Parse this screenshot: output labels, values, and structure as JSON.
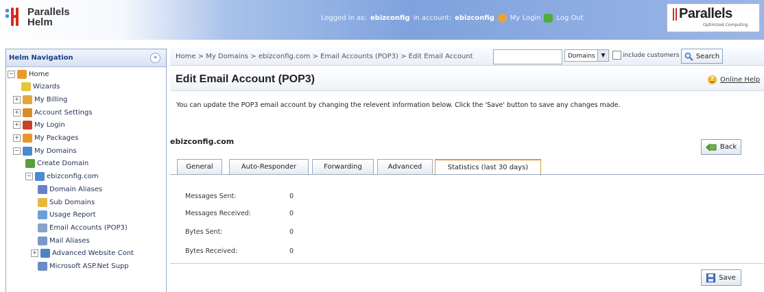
{
  "header": {
    "app_name_1": "Parallels",
    "app_name_2": "Helm",
    "logged_in_prefix": "Logged in as:",
    "logged_in_user": "ebizconfig",
    "account_prefix": "in account:",
    "account_name": "ebizconfig",
    "my_login": "My Login",
    "log_out": "Log Out",
    "brand_name": "Parallels",
    "brand_tagline": "Optimized Computing"
  },
  "sidebar": {
    "title": "Helm Navigation",
    "collapse_glyph": "«",
    "items": [
      {
        "label": "Home",
        "expander": "−",
        "icon": "home-icon",
        "color": "#e59b2a"
      },
      {
        "label": "Wizards",
        "expander": "",
        "icon": "wizard-icon",
        "color": "#e7c53a"
      },
      {
        "label": "My Billing",
        "expander": "+",
        "icon": "billing-icon",
        "color": "#e2a63b"
      },
      {
        "label": "Account Settings",
        "expander": "+",
        "icon": "account-settings-icon",
        "color": "#d98d2a"
      },
      {
        "label": "My Login",
        "expander": "+",
        "icon": "login-icon",
        "color": "#c8412a"
      },
      {
        "label": "My Packages",
        "expander": "+",
        "icon": "packages-icon",
        "color": "#e8962a"
      },
      {
        "label": "My Domains",
        "expander": "−",
        "icon": "domains-icon",
        "color": "#4c8ad0"
      },
      {
        "label": "Create Domain",
        "expander": "",
        "icon": "create-domain-icon",
        "color": "#5a9d3a"
      },
      {
        "label": "ebizconfig.com",
        "expander": "−",
        "icon": "domain-icon",
        "color": "#4c8ad0"
      },
      {
        "label": "Domain Aliases",
        "expander": "",
        "icon": "domain-aliases-icon",
        "color": "#6a7fcc"
      },
      {
        "label": "Sub Domains",
        "expander": "",
        "icon": "sub-domains-icon",
        "color": "#e7b83a"
      },
      {
        "label": "Usage Report",
        "expander": "",
        "icon": "usage-report-icon",
        "color": "#6aa0d8"
      },
      {
        "label": "Email Accounts (POP3)",
        "expander": "",
        "icon": "email-accounts-icon",
        "color": "#8aa2c8"
      },
      {
        "label": "Mail Aliases",
        "expander": "",
        "icon": "mail-aliases-icon",
        "color": "#7c98c8"
      },
      {
        "label": "Advanced Website Cont",
        "expander": "+",
        "icon": "advanced-website-icon",
        "color": "#4b83c6"
      },
      {
        "label": "Microsoft ASP.Net Supp",
        "expander": "",
        "icon": "aspnet-icon",
        "color": "#6b8cc4"
      }
    ]
  },
  "breadcrumb": "Home > My Domains > ebizconfig.com > Email Accounts (POP3) > Edit Email Account",
  "search": {
    "value": "",
    "scope": "Domains",
    "include_label": "include customers",
    "button": "Search"
  },
  "page": {
    "title": "Edit Email Account (POP3)",
    "help": "Online Help",
    "intro": "You can update the POP3 email account by changing the relevent information below. Click the 'Save' button to save any changes made.",
    "domain": "ebizconfig.com",
    "back": "Back",
    "save": "Save"
  },
  "tabs": [
    "General",
    "Auto-Responder",
    "Forwarding",
    "Advanced",
    "Statistics (last 30 days)"
  ],
  "active_tab": "Statistics (last 30 days)",
  "stats": [
    {
      "label": "Messages Sent:",
      "value": "0"
    },
    {
      "label": "Messages Received:",
      "value": "0"
    },
    {
      "label": "Bytes Sent:",
      "value": "0"
    },
    {
      "label": "Bytes Received:",
      "value": "0"
    }
  ],
  "colors": {
    "accent": "#1b3c86",
    "active_tab_border": "#d59a3c",
    "header_blue": "#7fa2dd"
  }
}
